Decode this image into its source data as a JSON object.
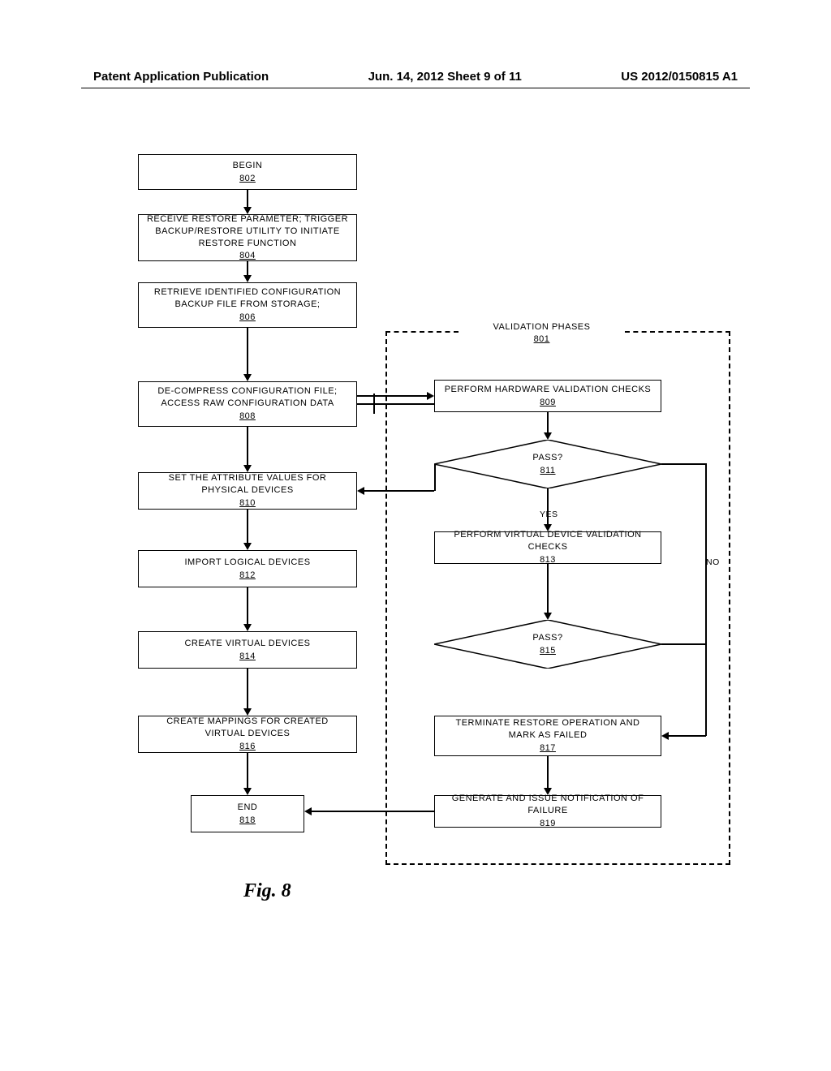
{
  "header": {
    "left": "Patent Application Publication",
    "center": "Jun. 14, 2012  Sheet 9 of 11",
    "right": "US 2012/0150815 A1"
  },
  "boxes": {
    "b802": {
      "text": "BEGIN",
      "ref": "802"
    },
    "b804": {
      "text": "RECEIVE RESTORE PARAMETER; TRIGGER BACKUP/RESTORE UTILITY TO INITIATE RESTORE FUNCTION",
      "ref": "804"
    },
    "b806": {
      "text": "RETRIEVE IDENTIFIED CONFIGURATION BACKUP FILE FROM STORAGE;",
      "ref": "806"
    },
    "b808": {
      "text": "DE-COMPRESS CONFIGURATION FILE; ACCESS RAW CONFIGURATION DATA",
      "ref": "808"
    },
    "b810": {
      "text": "SET THE ATTRIBUTE VALUES FOR PHYSICAL DEVICES",
      "ref": "810"
    },
    "b812": {
      "text": "IMPORT LOGICAL DEVICES",
      "ref": "812"
    },
    "b814": {
      "text": "CREATE VIRTUAL DEVICES",
      "ref": "814"
    },
    "b816": {
      "text": "CREATE MAPPINGS FOR CREATED VIRTUAL DEVICES",
      "ref": "816"
    },
    "b818": {
      "text": "END",
      "ref": "818"
    },
    "b809": {
      "text": "PERFORM HARDWARE VALIDATION CHECKS",
      "ref": "809"
    },
    "b813": {
      "text": "PERFORM VIRTUAL DEVICE VALIDATION CHECKS",
      "ref": "813"
    },
    "b817": {
      "text": "TERMINATE RESTORE OPERATION AND MARK AS FAILED",
      "ref": "817"
    },
    "b819": {
      "text": "GENERATE AND ISSUE NOTIFICATION OF FAILURE",
      "ref": "819"
    }
  },
  "diamonds": {
    "d811": {
      "text": "PASS?",
      "ref": "811"
    },
    "d815": {
      "text": "PASS?",
      "ref": "815"
    }
  },
  "validation": {
    "label": "VALIDATION PHASES",
    "ref": "801"
  },
  "labels": {
    "yes": "YES",
    "no": "NO"
  },
  "figure_caption": "Fig. 8"
}
